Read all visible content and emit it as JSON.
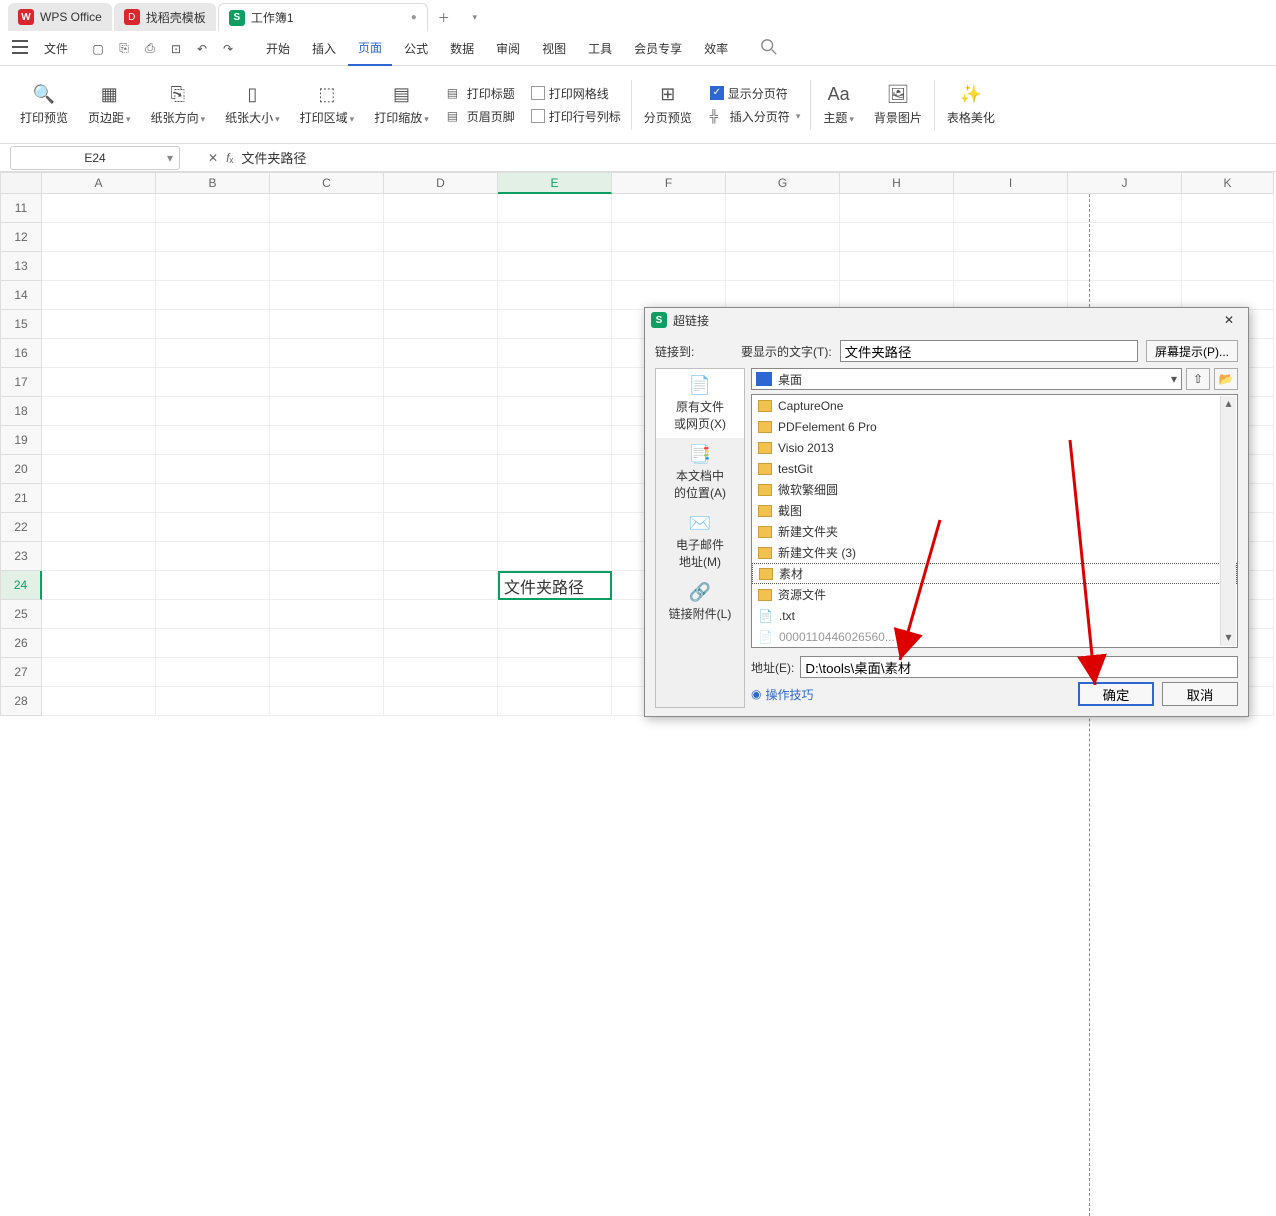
{
  "tabs": {
    "t0": "WPS Office",
    "t1": "找稻壳模板",
    "t2": "工作簿1"
  },
  "menu": {
    "file": "文件",
    "items": [
      "开始",
      "插入",
      "页面",
      "公式",
      "数据",
      "审阅",
      "视图",
      "工具",
      "会员专享",
      "效率"
    ],
    "active": 2
  },
  "ribbon": {
    "g_print_preview": "打印预览",
    "g_margins": "页边距",
    "g_orientation": "纸张方向",
    "g_size": "纸张大小",
    "g_print_area": "打印区域",
    "g_print_scaling": "打印缩放",
    "cb_print_title": "打印标题",
    "cb_print_grid": "打印网格线",
    "cb_header_footer": "页眉页脚",
    "cb_print_rowcol": "打印行号列标",
    "g_page_preview": "分页预览",
    "cb_show_break": "显示分页符",
    "g_insert_break": "插入分页符",
    "g_theme": "主题",
    "g_bg": "背景图片",
    "g_beautify": "表格美化"
  },
  "name_box": "E24",
  "formula": "文件夹路径",
  "columns": [
    "A",
    "B",
    "C",
    "D",
    "E",
    "F",
    "G",
    "H",
    "I",
    "J",
    "K"
  ],
  "rows": [
    "11",
    "12",
    "13",
    "14",
    "15",
    "16",
    "17",
    "18",
    "19",
    "20",
    "21",
    "22",
    "23",
    "24",
    "25",
    "26",
    "27",
    "28"
  ],
  "active_cell": {
    "row": "24",
    "col": "E",
    "text": "文件夹路径"
  },
  "dialog": {
    "title": "超链接",
    "link_to": "链接到:",
    "display_label": "要显示的文字(T):",
    "display_value": "文件夹路径",
    "tip_btn": "屏幕提示(P)...",
    "nav": {
      "n0": "原有文件\n或网页(X)",
      "n1": "本文档中\n的位置(A)",
      "n2": "电子邮件\n地址(M)",
      "n3": "链接附件(L)"
    },
    "loc_value": "桌面",
    "files": [
      "CaptureOne",
      "PDFelement 6 Pro",
      "Visio 2013",
      "testGit",
      "微软繁细圆",
      "截图",
      "新建文件夹",
      "新建文件夹 (3)",
      "素材",
      "资源文件",
      ".txt"
    ],
    "files_more": "0000110446026560...",
    "sel_file_index": 8,
    "addr_label": "地址(E):",
    "addr_value": "D:\\tools\\桌面\\素材",
    "op_hint": "操作技巧",
    "ok": "确定",
    "cancel": "取消"
  }
}
